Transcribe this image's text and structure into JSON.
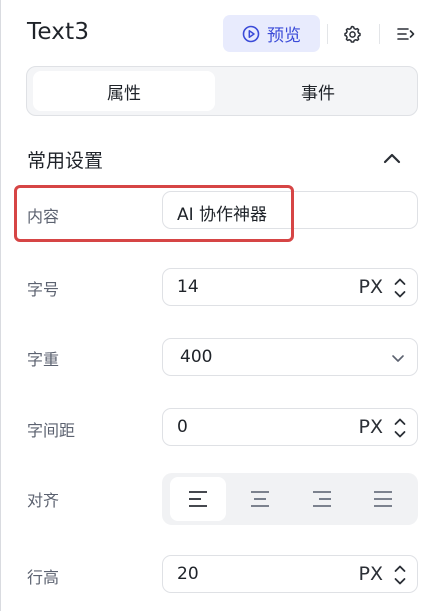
{
  "header": {
    "title": "Text3",
    "preview_label": "预览",
    "preview_icon": "play-circle-icon",
    "settings_icon": "gear-icon",
    "menu_icon": "collapse-panel-icon",
    "accent_color": "#3b4bd8"
  },
  "tabs": [
    {
      "label": "属性",
      "active": true
    },
    {
      "label": "事件",
      "active": false
    }
  ],
  "section": {
    "title": "常用设置",
    "collapse_icon": "chevron-up-icon"
  },
  "fields": {
    "content": {
      "label": "内容",
      "value": "AI 协作神器"
    },
    "font_size": {
      "label": "字号",
      "value": "14",
      "unit": "PX"
    },
    "font_weight": {
      "label": "字重",
      "value": "400"
    },
    "letter_spacing": {
      "label": "字间距",
      "value": "0",
      "unit": "PX"
    },
    "align": {
      "label": "对齐",
      "options": [
        "align-left-icon",
        "align-center-icon",
        "align-right-icon",
        "align-justify-icon"
      ],
      "selected": 0
    },
    "line_height": {
      "label": "行高",
      "value": "20",
      "unit": "PX"
    }
  }
}
